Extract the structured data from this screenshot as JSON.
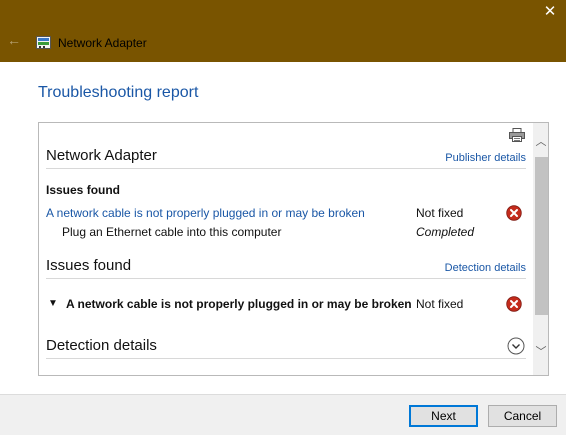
{
  "window": {
    "title": "Network Adapter",
    "close_glyph": "✕",
    "back_glyph": "←"
  },
  "report": {
    "title": "Troubleshooting report"
  },
  "section1": {
    "title": "Network Adapter",
    "link": "Publisher details",
    "issues_label": "Issues found",
    "issue_text": "A network cable is not properly plugged in or may be broken",
    "issue_status": "Not fixed",
    "step_text": "Plug an Ethernet cable into this computer",
    "step_status": "Completed"
  },
  "section2": {
    "title": "Issues found",
    "link": "Detection details",
    "expander_glyph": "▼",
    "issue_text": "A network cable is not properly plugged in or may be broken",
    "issue_status": "Not fixed"
  },
  "section3": {
    "title": "Detection details"
  },
  "scrollbar": {
    "up_glyph": "︿",
    "down_glyph": "﹀"
  },
  "footer": {
    "next_label": "Next",
    "cancel_label": "Cancel"
  },
  "colors": {
    "titlebar": "#795400",
    "link": "#1a57a6",
    "error": "#c42b1c"
  },
  "icons": [
    "close-icon",
    "back-arrow-icon",
    "network-adapter-icon",
    "printer-icon",
    "error-icon",
    "chevron-down-icon"
  ]
}
